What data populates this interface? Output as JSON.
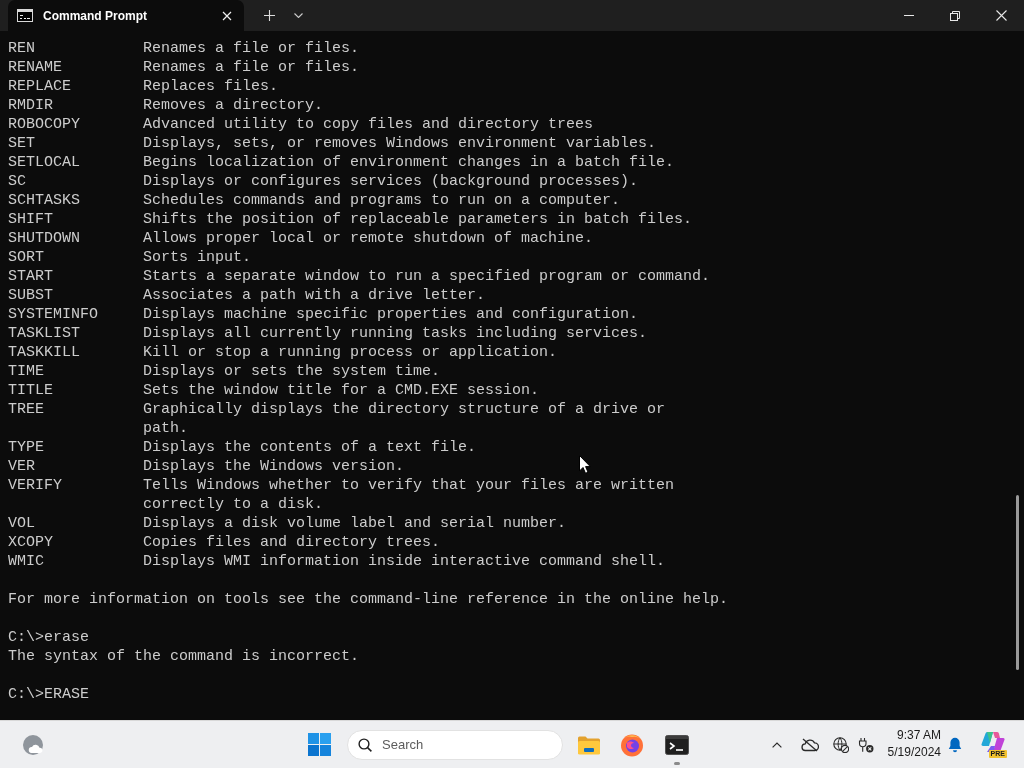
{
  "window": {
    "tabs": [
      {
        "title": "Command Prompt",
        "selected": true
      }
    ]
  },
  "terminal": {
    "blocks": [
      {
        "kind": "table",
        "rows": [
          {
            "command": "REN",
            "description": "Renames a file or files."
          },
          {
            "command": "RENAME",
            "description": "Renames a file or files."
          },
          {
            "command": "REPLACE",
            "description": "Replaces files."
          },
          {
            "command": "RMDIR",
            "description": "Removes a directory."
          },
          {
            "command": "ROBOCOPY",
            "description": "Advanced utility to copy files and directory trees"
          },
          {
            "command": "SET",
            "description": "Displays, sets, or removes Windows environment variables."
          },
          {
            "command": "SETLOCAL",
            "description": "Begins localization of environment changes in a batch file."
          },
          {
            "command": "SC",
            "description": "Displays or configures services (background processes)."
          },
          {
            "command": "SCHTASKS",
            "description": "Schedules commands and programs to run on a computer."
          },
          {
            "command": "SHIFT",
            "description": "Shifts the position of replaceable parameters in batch files."
          },
          {
            "command": "SHUTDOWN",
            "description": "Allows proper local or remote shutdown of machine."
          },
          {
            "command": "SORT",
            "description": "Sorts input."
          },
          {
            "command": "START",
            "description": "Starts a separate window to run a specified program or command."
          },
          {
            "command": "SUBST",
            "description": "Associates a path with a drive letter."
          },
          {
            "command": "SYSTEMINFO",
            "description": "Displays machine specific properties and configuration."
          },
          {
            "command": "TASKLIST",
            "description": "Displays all currently running tasks including services."
          },
          {
            "command": "TASKKILL",
            "description": "Kill or stop a running process or application."
          },
          {
            "command": "TIME",
            "description": "Displays or sets the system time."
          },
          {
            "command": "TITLE",
            "description": "Sets the window title for a CMD.EXE session."
          },
          {
            "command": "TREE",
            "description": "Graphically displays the directory structure of a drive or path."
          },
          {
            "command": "TYPE",
            "description": "Displays the contents of a text file."
          },
          {
            "command": "VER",
            "description": "Displays the Windows version."
          },
          {
            "command": "VERIFY",
            "description": "Tells Windows whether to verify that your files are written correctly to a disk."
          },
          {
            "command": "VOL",
            "description": "Displays a disk volume label and serial number."
          },
          {
            "command": "XCOPY",
            "description": "Copies files and directory trees."
          },
          {
            "command": "WMIC",
            "description": "Displays WMI information inside interactive command shell."
          }
        ]
      },
      {
        "kind": "text",
        "lines": [
          "For more information on tools see the command-line reference in the online help."
        ]
      },
      {
        "kind": "text",
        "lines": [
          "C:\\>erase",
          "The syntax of the command is incorrect."
        ]
      },
      {
        "kind": "text",
        "lines": [
          "C:\\>ERASE"
        ]
      }
    ]
  },
  "taskbar": {
    "search": {
      "placeholder": "Search"
    },
    "apps": [
      {
        "kind": "folder",
        "running": false
      },
      {
        "kind": "browser",
        "running": false
      },
      {
        "kind": "terminal",
        "running": true
      }
    ],
    "clock": {
      "time": "9:37 AM",
      "date": "5/19/2024"
    },
    "assistant_badge": "PRE"
  }
}
